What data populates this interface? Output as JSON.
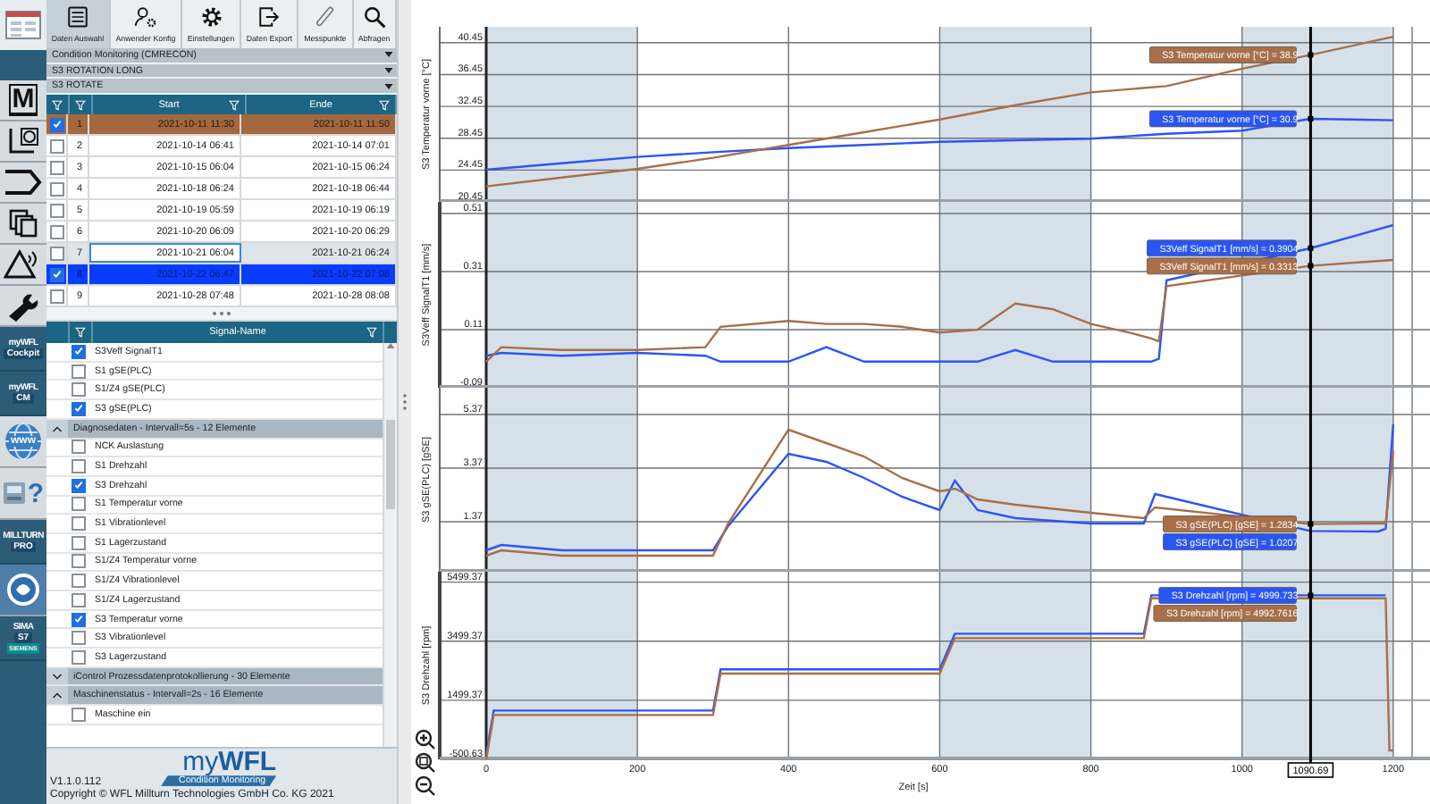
{
  "rail": [
    {
      "kind": "app"
    },
    {
      "kind": "module",
      "text": "M"
    },
    {
      "kind": "measure"
    },
    {
      "kind": "shape"
    },
    {
      "kind": "copy"
    },
    {
      "kind": "alarm"
    },
    {
      "kind": "tool"
    },
    {
      "kind": "badge",
      "lines": [
        "myWFL",
        "Cockpit"
      ]
    },
    {
      "kind": "badge",
      "lines": [
        "myWFL",
        "CM"
      ]
    },
    {
      "kind": "globe",
      "text": "www"
    },
    {
      "kind": "device",
      "text": "?"
    },
    {
      "kind": "badge",
      "lines": [
        "MILLTURN",
        "PRO"
      ]
    },
    {
      "kind": "emblem"
    },
    {
      "kind": "badge",
      "lines": [
        "SIMA",
        "S7",
        "SIEMENS"
      ]
    }
  ],
  "toolbar": [
    {
      "label": "Daten Auswahl",
      "selected": true
    },
    {
      "label": "Anwender Konfig",
      "selected": false
    },
    {
      "label": "Einstellungen",
      "selected": false
    },
    {
      "label": "Daten Export",
      "selected": false
    },
    {
      "label": "Messpunkte",
      "selected": false
    },
    {
      "label": "Abfragen",
      "selected": false
    }
  ],
  "selectors": [
    "Condition Monitoring (CMRECON)",
    "S3 ROTATION LONG",
    "S3 ROTATE"
  ],
  "sessions": {
    "columns": [
      "Start",
      "Ende"
    ],
    "rows": [
      {
        "checked": true,
        "focused": false,
        "color": "#a4683f",
        "number": "1",
        "start": "2021-10-11 11:30",
        "end": "2021-10-11 11:50"
      },
      {
        "checked": false,
        "focused": false,
        "number": "2",
        "start": "2021-10-14 06:41",
        "end": "2021-10-14 07:01"
      },
      {
        "checked": false,
        "focused": false,
        "number": "3",
        "start": "2021-10-15 06:04",
        "end": "2021-10-15 06:24"
      },
      {
        "checked": false,
        "focused": false,
        "number": "4",
        "start": "2021-10-18 06:24",
        "end": "2021-10-18 06:44"
      },
      {
        "checked": false,
        "focused": false,
        "number": "5",
        "start": "2021-10-19 05:59",
        "end": "2021-10-19 06:19"
      },
      {
        "checked": false,
        "focused": false,
        "number": "6",
        "start": "2021-10-20 06:09",
        "end": "2021-10-20 06:29"
      },
      {
        "checked": false,
        "focused": true,
        "number": "7",
        "start": "2021-10-21 06:04",
        "end": "2021-10-21 06:24"
      },
      {
        "checked": true,
        "focused": false,
        "color": "#0a3cff",
        "number": "8",
        "start": "2021-10-22 06:47",
        "end": "2021-10-22 07:08"
      },
      {
        "checked": false,
        "focused": false,
        "number": "9",
        "start": "2021-10-28 07:48",
        "end": "2021-10-28 08:08"
      }
    ]
  },
  "signals": {
    "header": "Signal-Name",
    "items": [
      {
        "kind": "item",
        "label": "S3Veff SignalT1",
        "checked": true
      },
      {
        "kind": "item",
        "label": "S1 gSE(PLC)",
        "checked": false
      },
      {
        "kind": "item",
        "label": "S1/Z4 gSE(PLC)",
        "checked": false
      },
      {
        "kind": "item",
        "label": "S3 gSE(PLC)",
        "checked": true
      },
      {
        "kind": "group",
        "label": "Diagnosedaten - Intervall=5s - 12 Elemente",
        "expanded": true,
        "children": [
          {
            "kind": "item",
            "label": "NCK Auslastung",
            "checked": false
          },
          {
            "kind": "item",
            "label": "S1 Drehzahl",
            "checked": false
          },
          {
            "kind": "item",
            "label": "S3 Drehzahl",
            "checked": true
          },
          {
            "kind": "item",
            "label": "S1 Temperatur vorne",
            "checked": false
          },
          {
            "kind": "item",
            "label": "S1 Vibrationlevel",
            "checked": false
          },
          {
            "kind": "item",
            "label": "S1 Lagerzustand",
            "checked": false
          },
          {
            "kind": "item",
            "label": "S1/Z4 Temperatur vorne",
            "checked": false
          },
          {
            "kind": "item",
            "label": "S1/Z4 Vibrationlevel",
            "checked": false
          },
          {
            "kind": "item",
            "label": "S1/Z4 Lagerzustand",
            "checked": false
          },
          {
            "kind": "item",
            "label": "S3 Temperatur vorne",
            "checked": true
          },
          {
            "kind": "item",
            "label": "S3 Vibrationlevel",
            "checked": false
          },
          {
            "kind": "item",
            "label": "S3 Lagerzustand",
            "checked": false
          }
        ]
      },
      {
        "kind": "group",
        "label": "iControl Prozessdatenprotokollierung - 30 Elemente",
        "expanded": false
      },
      {
        "kind": "group",
        "label": "Maschinenstatus - Intervall=2s - 16 Elemente",
        "expanded": true,
        "children": [
          {
            "kind": "item",
            "label": "Maschine ein",
            "checked": false
          }
        ]
      }
    ]
  },
  "footer": {
    "logo": "my**WFL**",
    "logo_banner": "Condition Monitoring",
    "version": "V1.1.0.112",
    "copyright": "Copyright © WFL Millturn Technologies GmbH Co. KG 2021"
  },
  "charts": [
    {
      "chart_data": {
        "type": "line",
        "grid": true,
        "ylabel": "S3 Temperatur vorne [°C]",
        "x": [
          0,
          100,
          200,
          300,
          400,
          500,
          600,
          700,
          800,
          900,
          1000,
          1090,
          1200
        ],
        "xlim": [
          0,
          1225
        ],
        "ylim": [
          20.45,
          42.45
        ],
        "yticks": [
          20.45,
          24.45,
          28.45,
          32.45,
          36.45,
          40.45
        ],
        "series": [
          {
            "color": "#2a55f5",
            "values": [
              24.5,
              25.3,
              26.1,
              26.7,
              27.2,
              27.6,
              28.0,
              28.2,
              28.4,
              29.0,
              29.4,
              30.9,
              30.7
            ]
          },
          {
            "color": "#a86f48",
            "values": [
              22.4,
              23.5,
              24.6,
              26.0,
              27.6,
              29.2,
              30.8,
              32.6,
              34.2,
              35.0,
              37.2,
              38.9,
              41.2
            ]
          }
        ],
        "ref_lines": [
          {
            "axis": "x",
            "value": 1090.69
          }
        ],
        "annotations": [
          "S3 Temperatur vorne [°C] = 30.9",
          "S3 Temperatur vorne [°C] = 38.9"
        ]
      }
    },
    {
      "chart_data": {
        "type": "line",
        "grid": true,
        "ylabel": "S3Veff SignalT1 [mm/s]",
        "x": [
          0,
          20,
          100,
          200,
          290,
          310,
          400,
          450,
          500,
          550,
          600,
          650,
          700,
          750,
          800,
          850,
          880,
          890,
          900,
          1090,
          1200
        ],
        "xlim": [
          0,
          1225
        ],
        "ylim": [
          -0.09,
          0.55
        ],
        "yticks": [
          -0.09,
          0.11,
          0.31,
          0.51
        ],
        "series": [
          {
            "color": "#2a55f5",
            "values": [
              0.02,
              0.03,
              0.02,
              0.03,
              0.02,
              0.0,
              0.0,
              0.05,
              0.0,
              0.0,
              0.0,
              0.0,
              0.04,
              0.0,
              0.0,
              0.0,
              0.0,
              0.01,
              0.28,
              0.39,
              0.47
            ]
          },
          {
            "color": "#a86f48",
            "values": [
              0.0,
              0.05,
              0.04,
              0.04,
              0.05,
              0.12,
              0.14,
              0.13,
              0.13,
              0.12,
              0.1,
              0.11,
              0.2,
              0.18,
              0.13,
              0.1,
              0.08,
              0.07,
              0.26,
              0.33,
              0.35
            ]
          }
        ],
        "ref_lines": [
          {
            "axis": "x",
            "value": 1090.69
          }
        ],
        "annotations": [
          "S3Veff SignalT1 [mm/s] = 0.3904",
          "S3Veff SignalT1 [mm/s] = 0.3313"
        ]
      }
    },
    {
      "chart_data": {
        "type": "line",
        "grid": true,
        "ylabel": "S3 gSE(PLC) [gSE]",
        "x": [
          0,
          20,
          100,
          200,
          300,
          320,
          400,
          450,
          500,
          550,
          600,
          620,
          650,
          700,
          800,
          870,
          885,
          1090,
          1180,
          1190,
          1200
        ],
        "xlim": [
          0,
          1225
        ],
        "ylim": [
          -0.5,
          6.37
        ],
        "yticks": [
          1.37,
          3.37,
          5.37
        ],
        "series": [
          {
            "color": "#2a55f5",
            "values": [
              0.3,
              0.5,
              0.3,
              0.3,
              0.3,
              1.2,
              3.9,
              3.6,
              3.0,
              2.3,
              1.8,
              2.9,
              1.8,
              1.5,
              1.3,
              1.3,
              2.4,
              1.02,
              1.0,
              1.1,
              5.0
            ]
          },
          {
            "color": "#a86f48",
            "values": [
              0.1,
              0.3,
              0.1,
              0.1,
              0.1,
              1.3,
              4.8,
              4.3,
              3.8,
              3.0,
              2.5,
              2.6,
              2.2,
              2.0,
              1.7,
              1.5,
              1.9,
              1.28,
              1.3,
              1.3,
              4.0
            ]
          }
        ],
        "ref_lines": [
          {
            "axis": "x",
            "value": 1090.69
          }
        ],
        "annotations": [
          "S3 gSE(PLC) [gSE] = 1.0207",
          "S3 gSE(PLC) [gSE] = 1.2834"
        ]
      }
    },
    {
      "chart_data": {
        "type": "line",
        "grid": true,
        "ylabel": "S3 Drehzahl [rpm]",
        "xlabel": "Zeit [s]",
        "x": [
          0,
          10,
          300,
          310,
          600,
          620,
          870,
          880,
          1190,
          1195,
          1200
        ],
        "xlim": [
          0,
          1225
        ],
        "ylim": [
          -500.63,
          5850
        ],
        "xticks": [
          0,
          200,
          400,
          600,
          800,
          1000,
          1200
        ],
        "yticks": [
          -500.63,
          1499.37,
          3499.37,
          5499.37
        ],
        "series": [
          {
            "color": "#2a55f5",
            "values": [
              -350,
              1150,
              1150,
              2550,
              2550,
              3750,
              3750,
              5050,
              5050,
              null,
              null
            ]
          },
          {
            "color": "#a86f48",
            "values": [
              -500,
              1000,
              1000,
              2400,
              2400,
              3600,
              3600,
              4950,
              4950,
              -200,
              -200
            ]
          }
        ],
        "ref_lines": [
          {
            "axis": "x",
            "value": 1090.69,
            "label": "1090.69"
          }
        ],
        "annotations": [
          "S3 Drehzahl [rpm] = 4999.733",
          "S3 Drehzahl [rpm] = 4992.7616"
        ]
      }
    }
  ]
}
